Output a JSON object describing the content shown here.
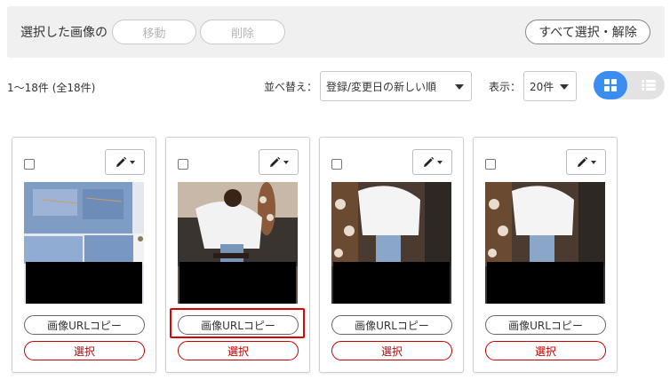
{
  "toolbar": {
    "label": "選択した画像の",
    "move_label": "移動",
    "delete_label": "削除",
    "select_all_label": "すべて選択・解除"
  },
  "list_controls": {
    "count_text": "1〜18件 (全18件)",
    "sort_label": "並べ替え：",
    "sort_value": "登録/変更日の新しい順",
    "display_label": "表示：",
    "display_value": "20件"
  },
  "view_modes": [
    "grid",
    "list"
  ],
  "active_view": "grid",
  "cards": [
    {
      "copy_label": "画像URLコピー",
      "select_label": "選択",
      "image": "jeans-collage"
    },
    {
      "copy_label": "画像URLコピー",
      "select_label": "選択",
      "image": "person-white-sweater-chair"
    },
    {
      "copy_label": "画像URLコピー",
      "select_label": "選択",
      "image": "person-white-sweater-giraffe"
    },
    {
      "copy_label": "画像URLコピー",
      "select_label": "選択",
      "image": "person-white-sweater-giraffe"
    }
  ],
  "colors": {
    "accent": "#3b8ef0",
    "danger": "#c00000",
    "toolbar_bg": "#f0f0f0"
  }
}
